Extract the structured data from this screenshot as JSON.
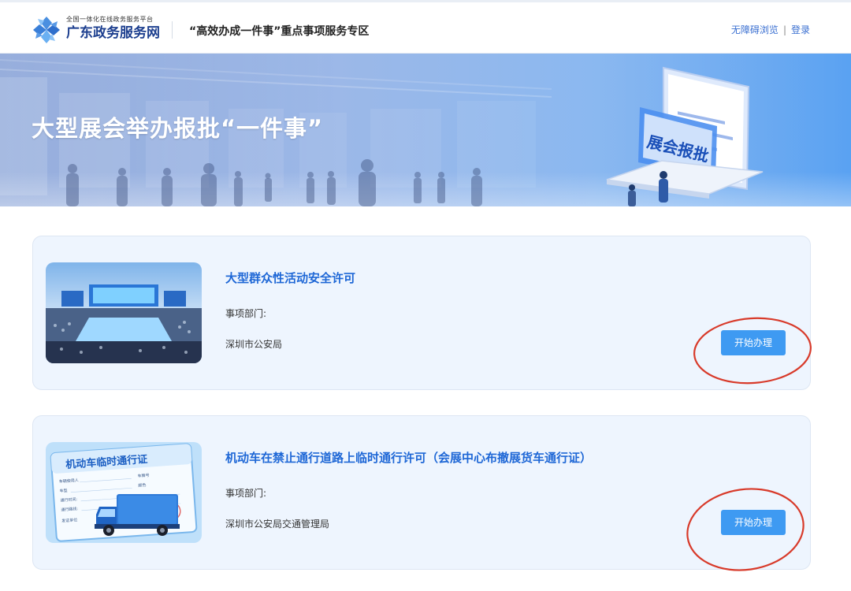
{
  "header": {
    "logo_small": "全国一体化在线政务服务平台",
    "logo_big": "广东政务服务网",
    "title": "“高效办成一件事”重点事项服务专区",
    "accessible_link": "无障碍浏览",
    "separator": "|",
    "login_link": "登录"
  },
  "banner": {
    "title": "大型展会举办报批“一件事”",
    "illustration_text": "展会报批"
  },
  "items": [
    {
      "title": "大型群众性活动安全许可",
      "dept_label": "事项部门:",
      "dept": "深圳市公安局",
      "button_label": "开始办理"
    },
    {
      "title": "机动车在禁止通行道路上临时通行许可（会展中心布撤展货车通行证）",
      "dept_label": "事项部门:",
      "dept": "深圳市公安局交通管理局",
      "button_label": "开始办理",
      "thumb": {
        "card_title": "机动车临时通行证",
        "row_1": "车辆使用人",
        "row_1b": "车牌号",
        "row_2": "车型",
        "row_2b": "颜色",
        "row_3": "通行时间:",
        "row_4": "通行路线:",
        "row_5": "发证单位"
      }
    }
  ],
  "colors": {
    "accent": "#3e9af2",
    "title_blue": "#1e67d6",
    "card_bg": "#eef5fe",
    "annotation_red": "#d83a2a"
  }
}
